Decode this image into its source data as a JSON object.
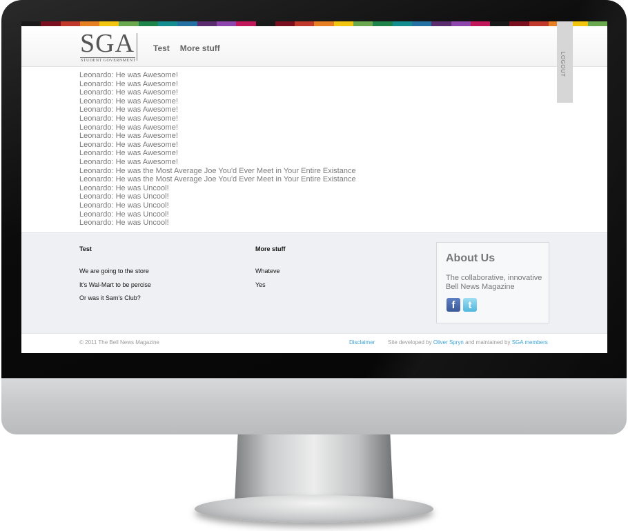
{
  "header": {
    "logo_text": "SGA",
    "logo_subtitle": "STUDENT GOVERNMENT",
    "nav": [
      "Test",
      "More stuff"
    ],
    "logout_label": "LOGOUT"
  },
  "colorbar": [
    "#1a1a1a",
    "#7a0f1f",
    "#c0392b",
    "#e67e22",
    "#f1c40f",
    "#6aa84f",
    "#1e8449",
    "#138d90",
    "#2471a3",
    "#5b2c6f",
    "#8e44ad",
    "#c2185b",
    "#1a1a1a",
    "#7a0f1f",
    "#c0392b",
    "#e67e22",
    "#f1c40f",
    "#6aa84f",
    "#1e8449",
    "#138d90",
    "#2471a3",
    "#5b2c6f",
    "#8e44ad",
    "#c2185b",
    "#1a1a1a",
    "#7a0f1f",
    "#c0392b",
    "#e67e22",
    "#f1c40f",
    "#6aa84f"
  ],
  "content": {
    "lines": [
      "Leonardo: He was Awesome!",
      "Leonardo: He was Awesome!",
      "Leonardo: He was Awesome!",
      "Leonardo: He was Awesome!",
      "Leonardo: He was Awesome!",
      "Leonardo: He was Awesome!",
      "Leonardo: He was Awesome!",
      "Leonardo: He was Awesome!",
      "Leonardo: He was Awesome!",
      "Leonardo: He was Awesome!",
      "Leonardo: He was Awesome!",
      "Leonardo: He was the Most Average Joe You'd Ever Meet in Your Entire Existance",
      "Leonardo: He was the Most Average Joe You'd Ever Meet in Your Entire Existance",
      "Leonardo: He was Uncool!",
      "Leonardo: He was Uncool!",
      "Leonardo: He was Uncool!",
      "Leonardo: He was Uncool!",
      "Leonardo: He was Uncool!"
    ]
  },
  "footer": {
    "col1": {
      "title": "Test",
      "links": [
        "We are going to the store",
        "It's Wal-Mart to be percise",
        "Or was it Sam's Club?"
      ]
    },
    "col2": {
      "title": "More stuff",
      "links": [
        "Whateve",
        "Yes"
      ]
    },
    "about": {
      "title": "About Us",
      "text": "The collaborative, innovative Bell News Magazine",
      "social": [
        {
          "icon": "facebook-icon",
          "glyph": "f"
        },
        {
          "icon": "twitter-icon",
          "glyph": "t"
        }
      ]
    }
  },
  "bottom": {
    "copyright": "© 2011 The Bell News Magazine",
    "disclaimer": "Disclaimer",
    "credits_prefix": "Site developed by",
    "developer": "Oliver Spryn",
    "credits_middle": "and maintained by",
    "maintainer": "SGA members"
  }
}
